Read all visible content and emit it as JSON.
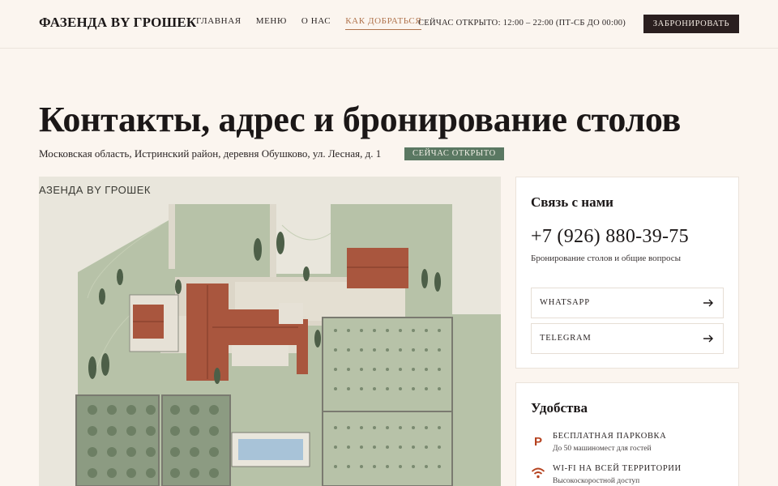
{
  "header": {
    "logo": "ФАЗЕНДА BY ГРОШЕК",
    "nav": [
      "ГЛАВНАЯ",
      "МЕНЮ",
      "О НАС",
      "КАК ДОБРАТЬСЯ"
    ],
    "active_nav": "КАК ДОБРАТЬСЯ",
    "hours": "СЕЙЧАС ОТКРЫТО: 12:00 – 22:00 (ПТ-СБ ДО 00:00)",
    "book_label": "ЗАБРОНИРОВАТЬ"
  },
  "page": {
    "title": "Контакты, адрес и бронирование столов",
    "address": "Московская область, Истринский район, деревня Обушково, ул. Лесная, д. 1",
    "status_badge": "СЕЙЧАС ОТКРЫТО"
  },
  "map": {
    "label": "АЗЕНДА BY ГРОШЕК"
  },
  "contact": {
    "title": "Связь с нами",
    "phone": "+7 (926) 880-39-75",
    "phone_note": "Бронирование столов и общие вопросы",
    "links": [
      {
        "label": "WHATSAPP",
        "icon": "arrow-right-icon"
      },
      {
        "label": "TELEGRAM",
        "icon": "arrow-right-icon"
      }
    ]
  },
  "amenities": {
    "title": "Удобства",
    "items": [
      {
        "name": "БЕСПЛАТНАЯ ПАРКОВКА",
        "desc": "До 50 машиномест для гостей",
        "icon": "parking-icon",
        "glyph": "P"
      },
      {
        "name": "WI-FI НА ВСЕЙ ТЕРРИТОРИИ",
        "desc": "Высокоскоростной доступ",
        "icon": "wifi-icon"
      }
    ]
  },
  "colors": {
    "background": "#fbf5ef",
    "accent": "#b0734c",
    "dark": "#2a1f1f",
    "badge": "#5a7862",
    "icon_accent": "#b5421f"
  }
}
